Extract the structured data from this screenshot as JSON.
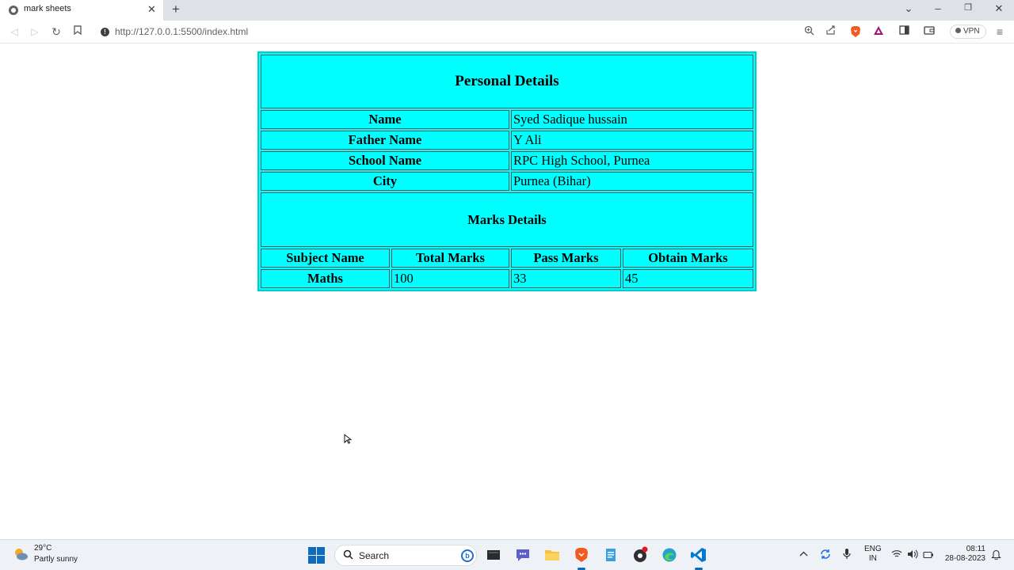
{
  "browser": {
    "tab_title": "mark sheets",
    "url": "http://127.0.0.1:5500/index.html",
    "vpn_label": "VPN"
  },
  "sheet": {
    "personal_heading": "Personal Details",
    "personal": [
      {
        "label": "Name",
        "value": "Syed Sadique hussain"
      },
      {
        "label": "Father Name",
        "value": "Y Ali"
      },
      {
        "label": "School Name",
        "value": "RPC High School, Purnea"
      },
      {
        "label": "City",
        "value": "Purnea (Bihar)"
      }
    ],
    "marks_heading": "Marks Details",
    "marks_columns": [
      "Subject Name",
      "Total Marks",
      "Pass Marks",
      "Obtain Marks"
    ],
    "marks_rows": [
      {
        "subject": "Maths",
        "total": "100",
        "pass": "33",
        "obtain": "45"
      }
    ],
    "bg_color": "#00ffff"
  },
  "taskbar": {
    "temperature": "29°C",
    "weather": "Partly sunny",
    "search_label": "Search",
    "lang_line1": "ENG",
    "lang_line2": "IN",
    "time": "08:11",
    "date": "28-08-2023"
  }
}
